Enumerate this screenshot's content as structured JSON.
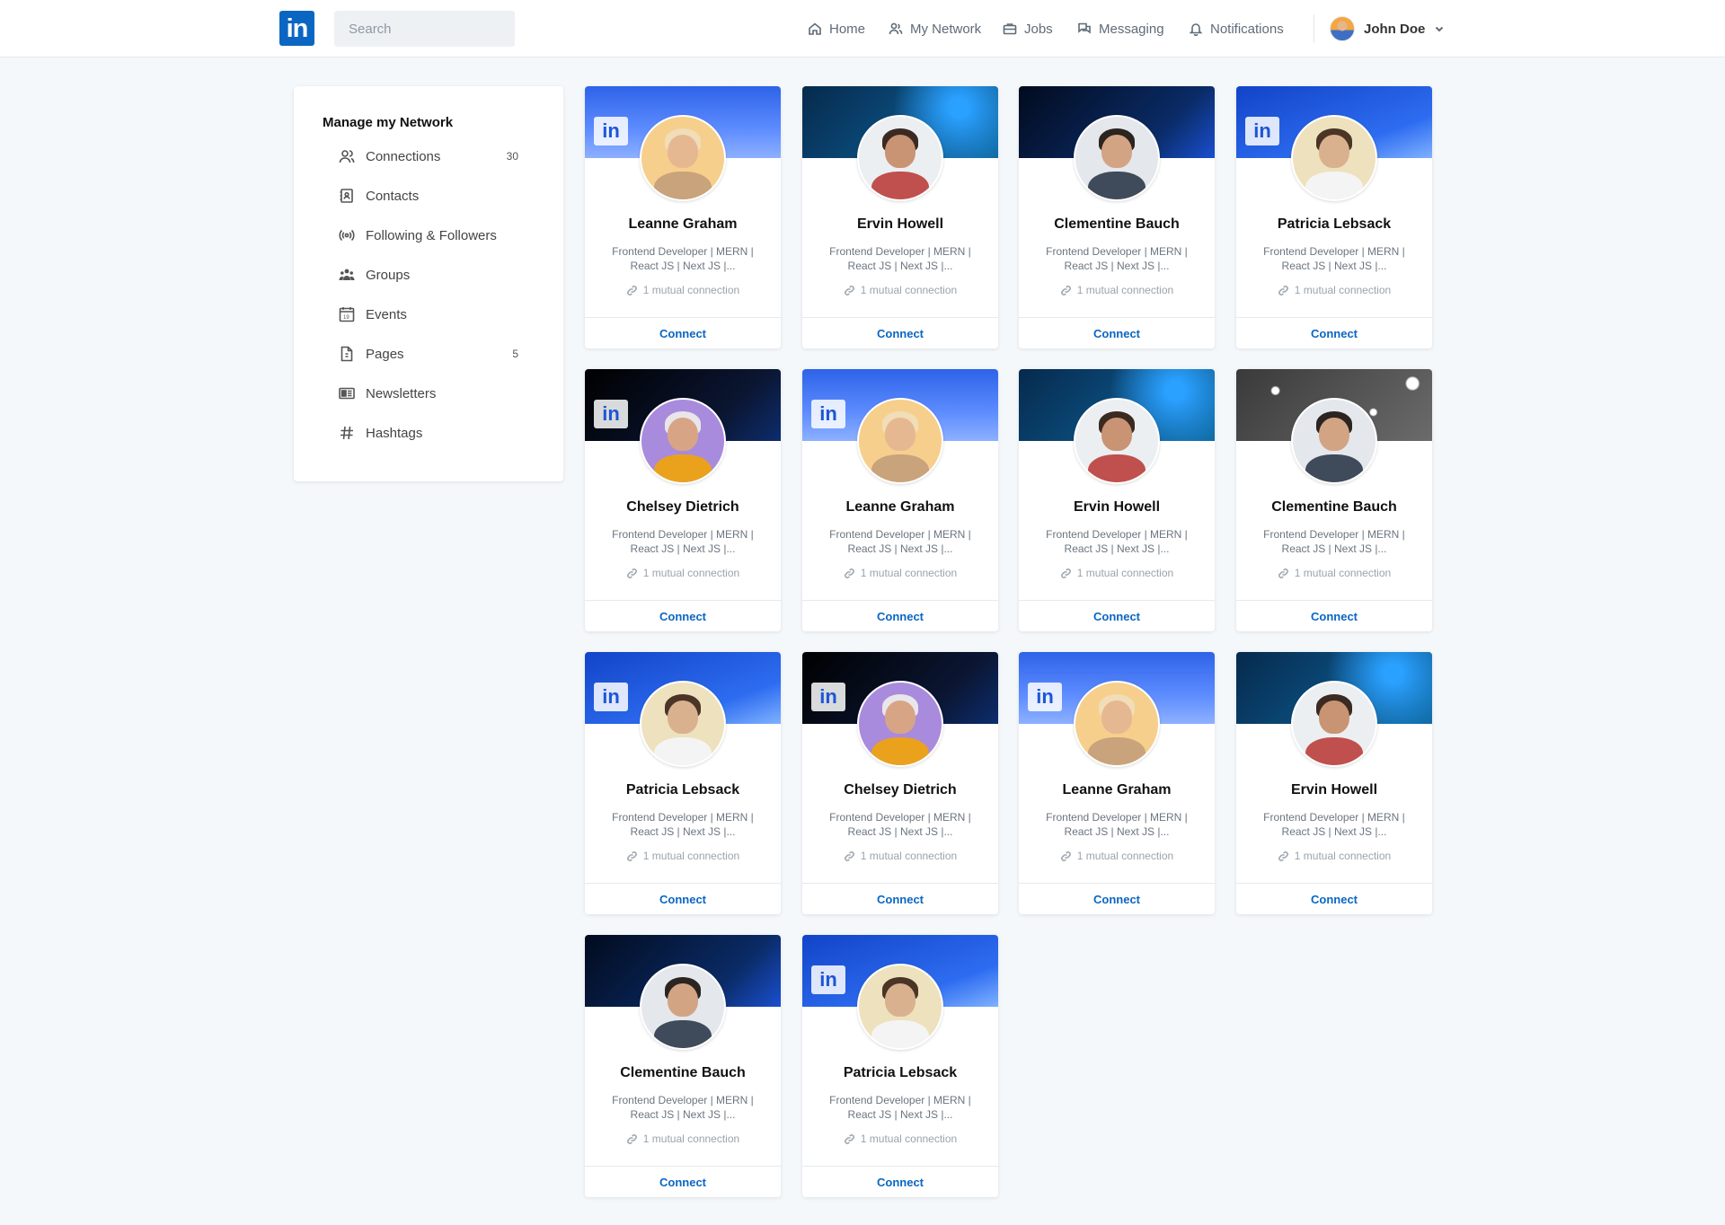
{
  "header": {
    "logo_text": "in",
    "search_placeholder": "Search",
    "nav": [
      {
        "label": "Home",
        "icon": "home-icon"
      },
      {
        "label": "My Network",
        "icon": "people-icon"
      },
      {
        "label": "Jobs",
        "icon": "briefcase-icon"
      },
      {
        "label": "Messaging",
        "icon": "chat-icon"
      },
      {
        "label": "Notifications",
        "icon": "bell-icon"
      }
    ],
    "profile_name": "John Doe"
  },
  "sidebar": {
    "title": "Manage my Network",
    "items": [
      {
        "label": "Connections",
        "count": "30",
        "icon": "connections-icon"
      },
      {
        "label": "Contacts",
        "count": "",
        "icon": "contacts-icon"
      },
      {
        "label": "Following & Followers",
        "count": "",
        "icon": "broadcast-icon"
      },
      {
        "label": "Groups",
        "count": "",
        "icon": "groups-icon"
      },
      {
        "label": "Events",
        "count": "",
        "icon": "calendar-icon"
      },
      {
        "label": "Pages",
        "count": "5",
        "icon": "page-icon"
      },
      {
        "label": "Newsletters",
        "count": "",
        "icon": "newsletter-icon"
      },
      {
        "label": "Hashtags",
        "count": "",
        "icon": "hashtag-icon"
      }
    ]
  },
  "card_common": {
    "headline": "Frontend Developer | MERN | React JS | Next JS |...",
    "mutual": "1 mutual connection",
    "connect_label": "Connect"
  },
  "cards": [
    {
      "name": "Leanne Graham",
      "banner": "brand",
      "avatar": "blonde"
    },
    {
      "name": "Ervin Howell",
      "banner": "net",
      "avatar": "beard"
    },
    {
      "name": "Clementine Bauch",
      "banner": "dark",
      "avatar": "woman"
    },
    {
      "name": "Patricia Lebsack",
      "banner": "logo",
      "avatar": "man"
    },
    {
      "name": "Chelsey Dietrich",
      "banner": "black",
      "avatar": "yellow"
    },
    {
      "name": "Leanne Graham",
      "banner": "brand",
      "avatar": "blonde"
    },
    {
      "name": "Ervin Howell",
      "banner": "net",
      "avatar": "beard"
    },
    {
      "name": "Clementine Bauch",
      "banner": "sparkle",
      "avatar": "woman"
    },
    {
      "name": "Patricia Lebsack",
      "banner": "logo",
      "avatar": "man"
    },
    {
      "name": "Chelsey Dietrich",
      "banner": "black",
      "avatar": "yellow"
    },
    {
      "name": "Leanne Graham",
      "banner": "brand",
      "avatar": "blonde"
    },
    {
      "name": "Ervin Howell",
      "banner": "net",
      "avatar": "beard"
    },
    {
      "name": "Clementine Bauch",
      "banner": "dark",
      "avatar": "woman"
    },
    {
      "name": "Patricia Lebsack",
      "banner": "logo",
      "avatar": "man"
    }
  ],
  "colors": {
    "accent": "#0a66c2",
    "background": "#f5f8fb"
  }
}
